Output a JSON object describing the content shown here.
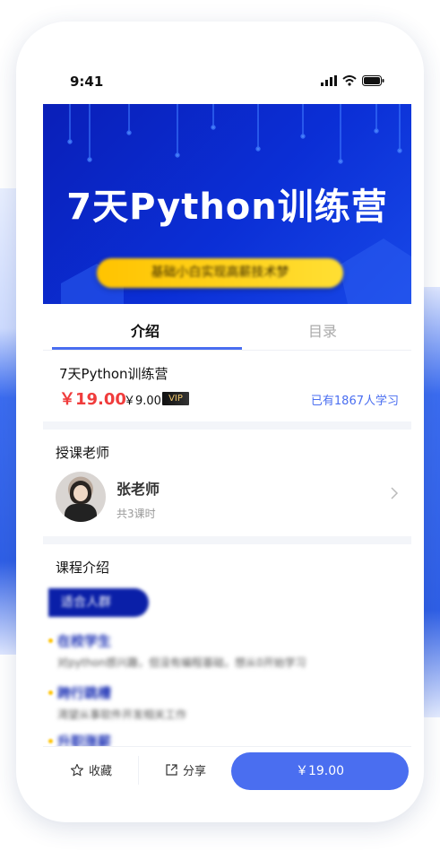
{
  "status_bar": {
    "time": "9:41"
  },
  "banner": {
    "title": "7天Python训练营",
    "subtitle": "基础小白实现高薪技术梦"
  },
  "tabs": [
    {
      "label": "介绍"
    },
    {
      "label": "目录"
    }
  ],
  "course": {
    "name": "7天Python训练营",
    "price": "￥19.00",
    "vip_price": "￥9.00",
    "vip_badge": "VIP",
    "learners": "已有1867人学习"
  },
  "teacher_section": {
    "title": "授课老师",
    "name": "张老师",
    "lessons": "共3课时"
  },
  "intro_section": {
    "title": "课程介绍",
    "badge": "适合人群",
    "items": [
      {
        "head": "在校学生",
        "body": "对python感兴趣，但没有编程基础，想从0开始学习"
      },
      {
        "head": "跨行跳槽",
        "body": "渴望从事软件开发相关工作"
      },
      {
        "head": "升职涨薪",
        "body": ""
      }
    ]
  },
  "bottom_bar": {
    "favorite_label": "收藏",
    "share_label": "分享",
    "buy_label": "￥19.00"
  },
  "colors": {
    "accent": "#4a6ef0",
    "price": "#f03c3c",
    "banner": "#0b2fd6"
  }
}
